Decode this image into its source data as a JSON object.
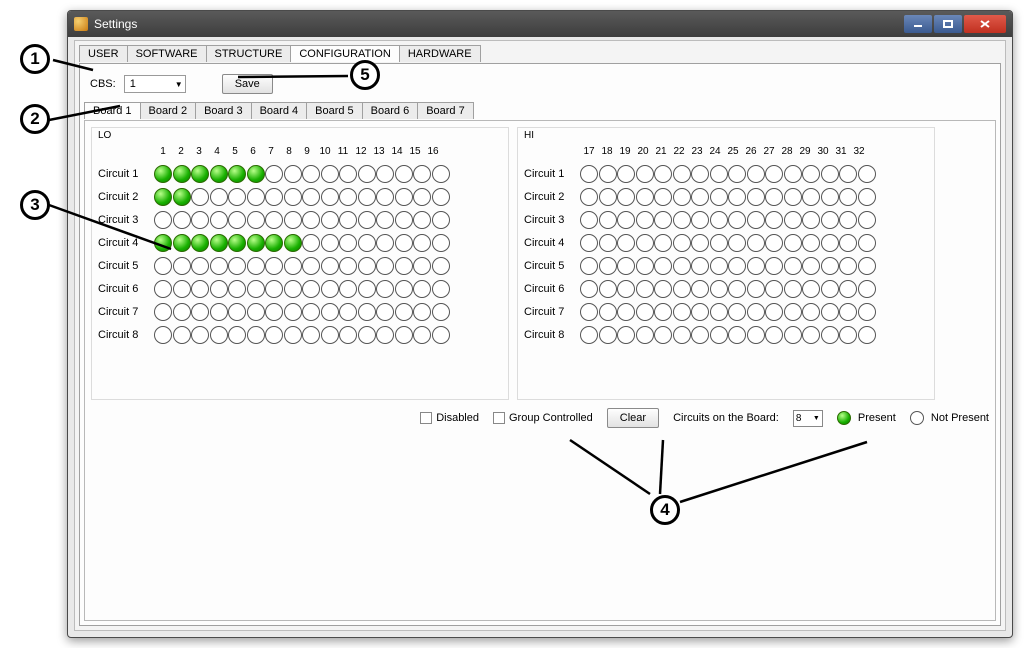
{
  "window": {
    "title": "Settings"
  },
  "tabs": {
    "main": [
      "USER",
      "SOFTWARE",
      "STRUCTURE",
      "CONFIGURATION",
      "HARDWARE"
    ],
    "active": "CONFIGURATION"
  },
  "toprow": {
    "cbs_label": "CBS:",
    "cbs_value": "1",
    "save_label": "Save"
  },
  "board_tabs": [
    "Board 1",
    "Board 2",
    "Board 3",
    "Board 4",
    "Board 5",
    "Board 6",
    "Board 7"
  ],
  "board_active": "Board 1",
  "lo": {
    "title": "LO",
    "cols": [
      "1",
      "2",
      "3",
      "4",
      "5",
      "6",
      "7",
      "8",
      "9",
      "10",
      "11",
      "12",
      "13",
      "14",
      "15",
      "16"
    ],
    "rows": [
      "Circuit 1",
      "Circuit 2",
      "Circuit 3",
      "Circuit 4",
      "Circuit 5",
      "Circuit 6",
      "Circuit 7",
      "Circuit 8"
    ],
    "present": {
      "Circuit 1": [
        1,
        2,
        3,
        4,
        5,
        6
      ],
      "Circuit 2": [
        1,
        2
      ],
      "Circuit 3": [],
      "Circuit 4": [
        1,
        2,
        3,
        4,
        5,
        6,
        7,
        8
      ],
      "Circuit 5": [],
      "Circuit 6": [],
      "Circuit 7": [],
      "Circuit 8": []
    }
  },
  "hi": {
    "title": "HI",
    "cols": [
      "17",
      "18",
      "19",
      "20",
      "21",
      "22",
      "23",
      "24",
      "25",
      "26",
      "27",
      "28",
      "29",
      "30",
      "31",
      "32"
    ],
    "rows": [
      "Circuit 1",
      "Circuit 2",
      "Circuit 3",
      "Circuit 4",
      "Circuit 5",
      "Circuit 6",
      "Circuit 7",
      "Circuit 8"
    ]
  },
  "bottom": {
    "disabled_label": "Disabled",
    "group_label": "Group Controlled",
    "clear_label": "Clear",
    "cob_label": "Circuits on the Board:",
    "cob_value": "8",
    "present_label": "Present",
    "notpresent_label": "Not Present"
  },
  "callouts": {
    "1": "1",
    "2": "2",
    "3": "3",
    "4": "4",
    "5": "5"
  }
}
